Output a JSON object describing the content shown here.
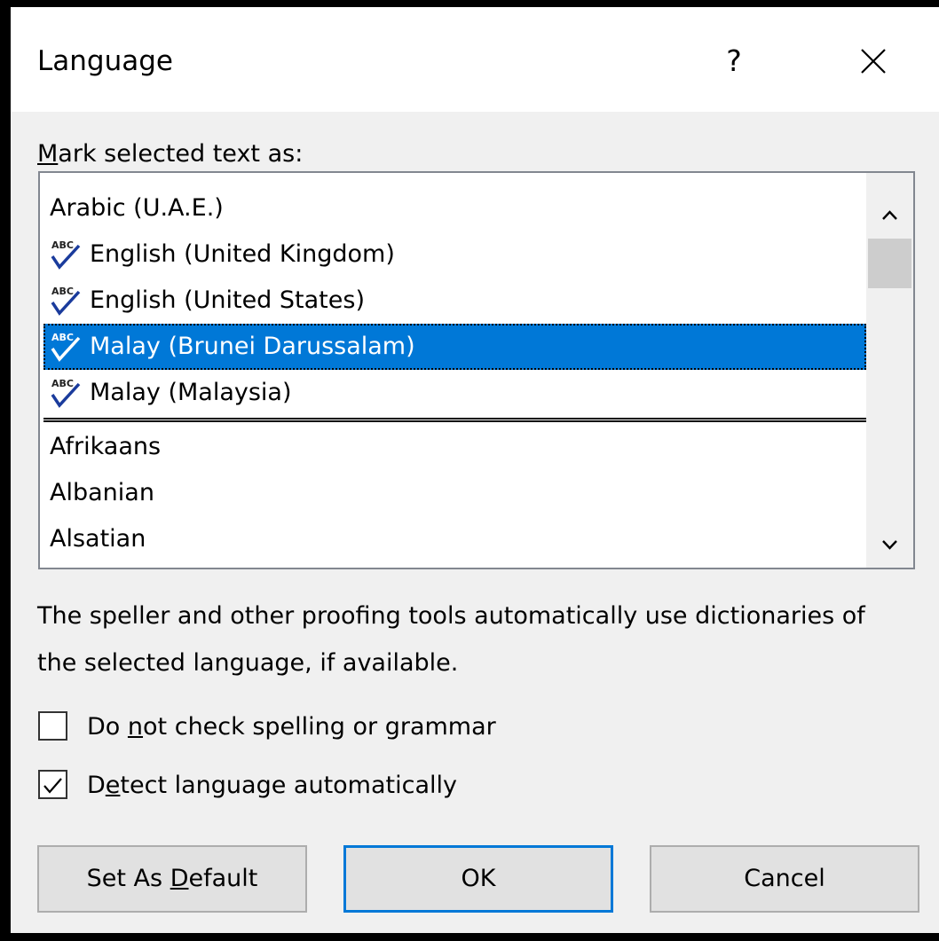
{
  "dialog": {
    "title": "Language",
    "help_label": "?"
  },
  "list_section": {
    "label_prefix": "M",
    "label_rest": "ark selected text as:"
  },
  "recent_languages": [
    {
      "label": "Arabic (U.A.E.)",
      "proofing_icon": false,
      "selected": false
    },
    {
      "label": "English (United Kingdom)",
      "proofing_icon": true,
      "selected": false
    },
    {
      "label": "English (United States)",
      "proofing_icon": true,
      "selected": false
    },
    {
      "label": "Malay (Brunei Darussalam)",
      "proofing_icon": true,
      "selected": true
    },
    {
      "label": "Malay (Malaysia)",
      "proofing_icon": true,
      "selected": false
    }
  ],
  "all_languages": [
    {
      "label": "Afrikaans"
    },
    {
      "label": "Albanian"
    },
    {
      "label": "Alsatian"
    }
  ],
  "info_text": "The speller and other proofing tools automatically use dictionaries of the selected language, if available.",
  "options": {
    "no_check": {
      "before": "Do ",
      "accel": "n",
      "after": "ot check spelling or grammar",
      "checked": false
    },
    "detect": {
      "before": "D",
      "accel": "e",
      "after": "tect language automatically",
      "checked": true
    }
  },
  "buttons": {
    "set_default": {
      "before": "Set As ",
      "accel": "D",
      "after": "efault"
    },
    "ok": "OK",
    "cancel": "Cancel"
  },
  "colors": {
    "selection": "#0078d7",
    "proofing_check": "#1a3b9c"
  },
  "icons": {
    "proofing": "abc-spellcheck-icon",
    "close": "close-icon",
    "scroll_up": "chevron-up-icon",
    "scroll_down": "chevron-down-icon",
    "checkmark": "checkmark-icon"
  }
}
